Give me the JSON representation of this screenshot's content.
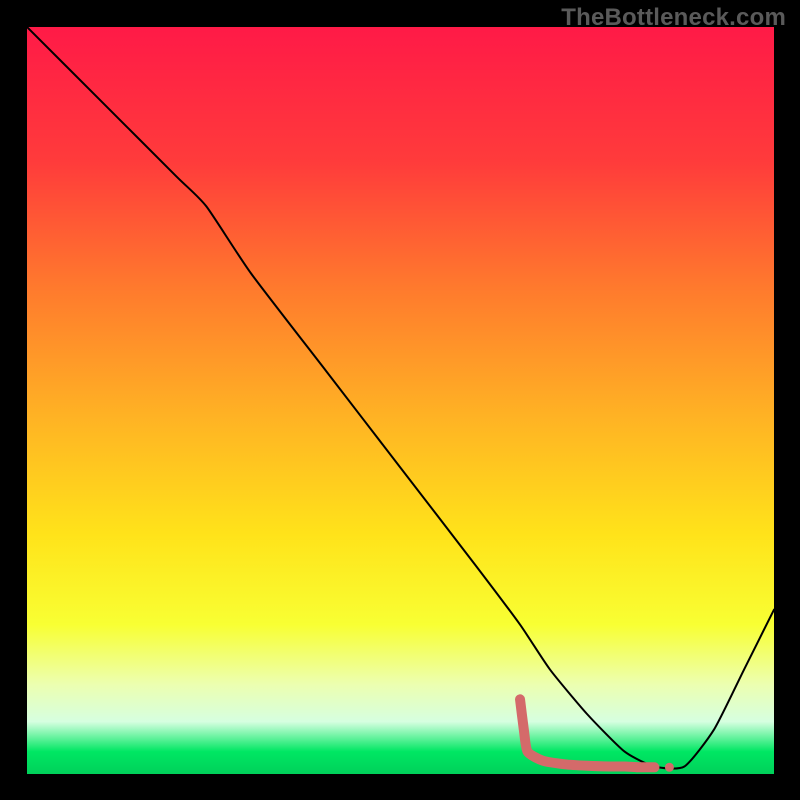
{
  "watermark": "TheBottleneck.com",
  "chart_data": {
    "type": "line",
    "title": "",
    "xlabel": "",
    "ylabel": "",
    "xlim": [
      0,
      100
    ],
    "ylim": [
      0,
      100
    ],
    "grid": false,
    "legend": false,
    "background_gradient": {
      "stops": [
        {
          "offset": 0.0,
          "color": "#ff1a47"
        },
        {
          "offset": 0.18,
          "color": "#ff3b3b"
        },
        {
          "offset": 0.35,
          "color": "#ff7a2d"
        },
        {
          "offset": 0.52,
          "color": "#ffb224"
        },
        {
          "offset": 0.68,
          "color": "#ffe31a"
        },
        {
          "offset": 0.8,
          "color": "#f8ff33"
        },
        {
          "offset": 0.88,
          "color": "#ecffb0"
        },
        {
          "offset": 0.93,
          "color": "#d6ffe0"
        },
        {
          "offset": 0.97,
          "color": "#00e763"
        },
        {
          "offset": 1.0,
          "color": "#00d15a"
        }
      ]
    },
    "series": [
      {
        "name": "bottleneck-curve",
        "color": "#000000",
        "stroke_width": 2,
        "x": [
          0,
          10,
          20,
          24,
          30,
          40,
          50,
          60,
          66,
          70,
          75,
          80,
          84,
          88,
          92,
          96,
          100
        ],
        "y": [
          100,
          90,
          80,
          76,
          67,
          54,
          41,
          28,
          20,
          14,
          8,
          3,
          1,
          1,
          6,
          14,
          22
        ]
      }
    ],
    "markers": [
      {
        "name": "highlight-region",
        "color": "#d46a6a",
        "stroke_width": 10,
        "linecap": "round",
        "x": [
          66,
          66.5,
          67,
          69,
          72,
          75,
          78,
          80,
          82,
          84
        ],
        "y": [
          10,
          6,
          3,
          1.8,
          1.3,
          1.1,
          1.0,
          1.0,
          0.9,
          0.9
        ]
      }
    ],
    "dots": [
      {
        "name": "dot-1",
        "x": 86,
        "y": 0.9,
        "r": 4.5,
        "color": "#d46a6a"
      }
    ]
  }
}
